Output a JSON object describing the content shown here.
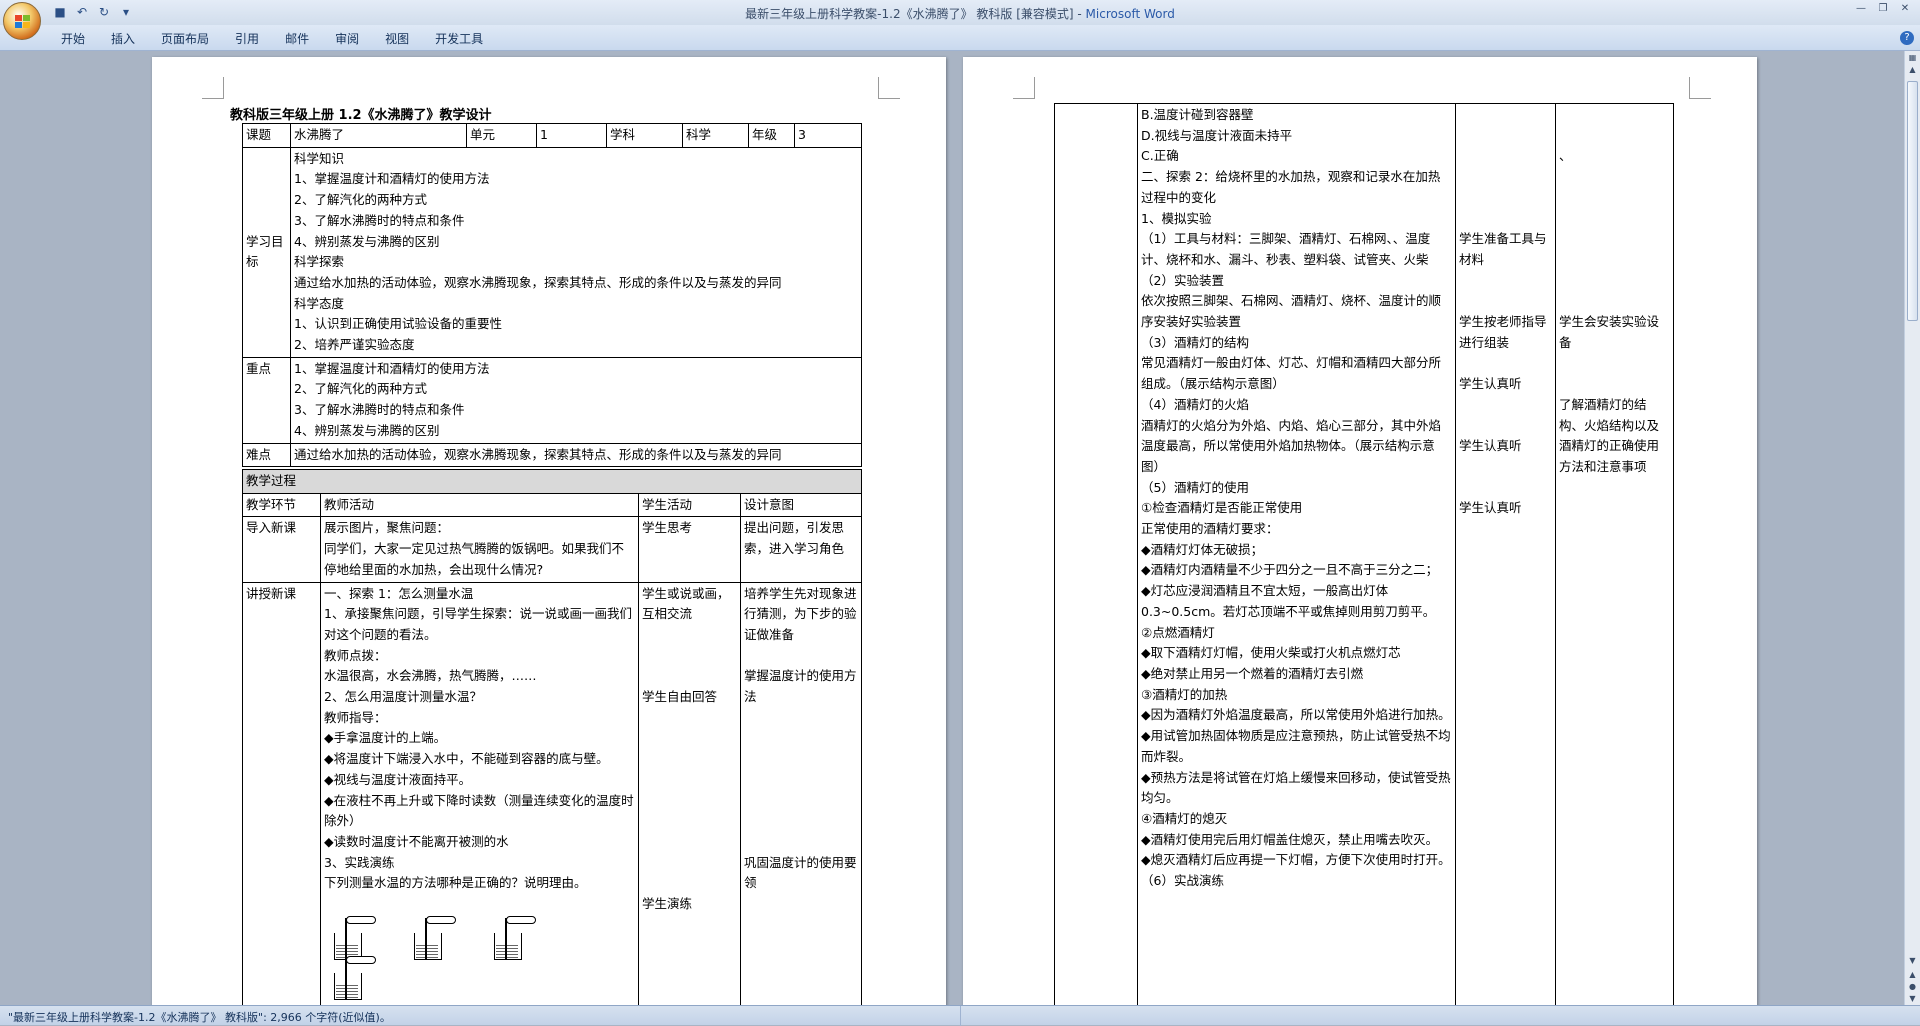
{
  "window": {
    "title_doc": "最新三年级上册科学教案-1.2《水沸腾了》 教科版 [兼容模式] - ",
    "title_app": "Microsoft Word"
  },
  "ribbon": {
    "tabs": [
      "开始",
      "插入",
      "页面布局",
      "引用",
      "邮件",
      "审阅",
      "视图",
      "开发工具"
    ]
  },
  "page1": {
    "doc_title": "教科版三年级上册 1.2《水沸腾了》教学设计",
    "header_row": [
      "课题",
      "水沸腾了",
      "单元",
      "1",
      "学科",
      "科学",
      "年级",
      "3"
    ],
    "goals_label": "学习目标",
    "goals_text": "科学知识\n1、掌握温度计和酒精灯的使用方法\n2、了解汽化的两种方式\n3、了解水沸腾时的特点和条件\n4、辨别蒸发与沸腾的区别\n科学探索\n通过给水加热的活动体验，观察水沸腾现象，探索其特点、形成的条件以及与蒸发的异同\n科学态度\n1、认识到正确使用试验设备的重要性\n2、培养严谨实验态度",
    "key_label": "重点",
    "key_text": "1、掌握温度计和酒精灯的使用方法\n2、了解汽化的两种方式\n3、了解水沸腾时的特点和条件\n4、辨别蒸发与沸腾的区别",
    "diff_label": "难点",
    "diff_text": "通过给水加热的活动体验，观察水沸腾现象，探索其特点、形成的条件以及与蒸发的异同",
    "process_label": "教学过程",
    "process_headers": [
      "教学环节",
      "教师活动",
      "学生活动",
      "设计意图"
    ],
    "intro": {
      "stage": "导入新课",
      "teacher": "展示图片，聚焦问题：\n同学们，大家一定见过热气腾腾的饭锅吧。如果我们不停地给里面的水加热，会出现什么情况?",
      "student": "学生思考",
      "intent": " 提出问题，引发思索，进入学习角色"
    },
    "lesson": {
      "stage": "讲授新课",
      "teacher": "一、探索 1：怎么测量水温\n1、承接聚焦问题，引导学生探索：说一说或画一画我们对这个问题的看法。\n教师点拨：\n水温很高，水会沸腾，热气腾腾，……\n2、怎么用温度计测量水温？\n教师指导：\n◆手拿温度计的上端。\n◆将温度计下端浸入水中，不能碰到容器的底与壁。\n◆视线与温度计液面持平。\n◆在液柱不再上升或下降时读数（测量连续变化的温度时除外）\n◆读数时温度计不能离开被测的水\n3、实践演练\n下列测量水温的方法哪种是正确的？说明理由。",
      "student": "学生或说或画，互相交流\n\n\n\n学生自由回答\n\n\n\n\n\n\n\n\n\n学生演练",
      "intent": "培养学生先对现象进行猜测，为下步的验证做准备\n\n掌握温度计的使用方法\n\n\n\n\n\n\n\n巩固温度计的使用要领"
    }
  },
  "page2": {
    "col_teacher": "B.温度计碰到容器壁\nD.视线与温度计液面未持平\nC.正确\n二、探索 2：给烧杯里的水加热，观察和记录水在加热过程中的变化\n1、模拟实验\n（1）工具与材料：三脚架、酒精灯、石棉网、、温度计、烧杯和水、漏斗、秒表、塑料袋、试管夹、火柴\n（2）实验装置\n依次按照三脚架、石棉网、酒精灯、烧杯、温度计的顺序安装好实验装置\n（3）酒精灯的结构\n常见酒精灯一般由灯体、灯芯、灯帽和酒精四大部分所组成。（展示结构示意图）\n（4）酒精灯的火焰\n酒精灯的火焰分为外焰、内焰、焰心三部分，其中外焰温度最高，所以常使用外焰加热物体。（展示结构示意图）\n（5）酒精灯的使用\n①检查酒精灯是否能正常使用\n正常使用的酒精灯要求：\n◆酒精灯灯体无破损；\n◆酒精灯内酒精量不少于四分之一且不高于三分之二；\n◆灯芯应浸润酒精且不宜太短，一般高出灯体 0.3~0.5cm。若灯芯顶端不平或焦掉则用剪刀剪平。\n②点燃酒精灯\n◆取下酒精灯灯帽，使用火柴或打火机点燃灯芯\n◆绝对禁止用另一个燃着的酒精灯去引燃\n③酒精灯的加热\n◆因为酒精灯外焰温度最高，所以常使用外焰进行加热。\n◆用试管加热固体物质是应注意预热，防止试管受热不均而炸裂。\n◆预热方法是将试管在灯焰上缓慢来回移动，使试管受热均匀。\n④酒精灯的熄灭\n◆酒精灯使用完后用灯帽盖住熄灭，禁止用嘴去吹灭。\n◆熄灭酒精灯后应再提一下灯帽，方便下次使用时打开。\n（6）实战演练",
    "col_student": "\n\n\n\n\n\n学生准备工具与材料\n\n\n学生按老师指导进行组装\n\n学生认真听\n\n\n学生认真听\n\n\n学生认真听",
    "col_intent": "\n\n、\n\n\n\n\n\n\n\n学生会安装实验设备\n\n\n了解酒精灯的结构、火焰结构以及酒精灯的正确使用方法和注意事项"
  },
  "status": {
    "text": "\"最新三年级上册科学教案-1.2《水沸腾了》 教科版\": 2,966 个字符(近似值)。"
  }
}
